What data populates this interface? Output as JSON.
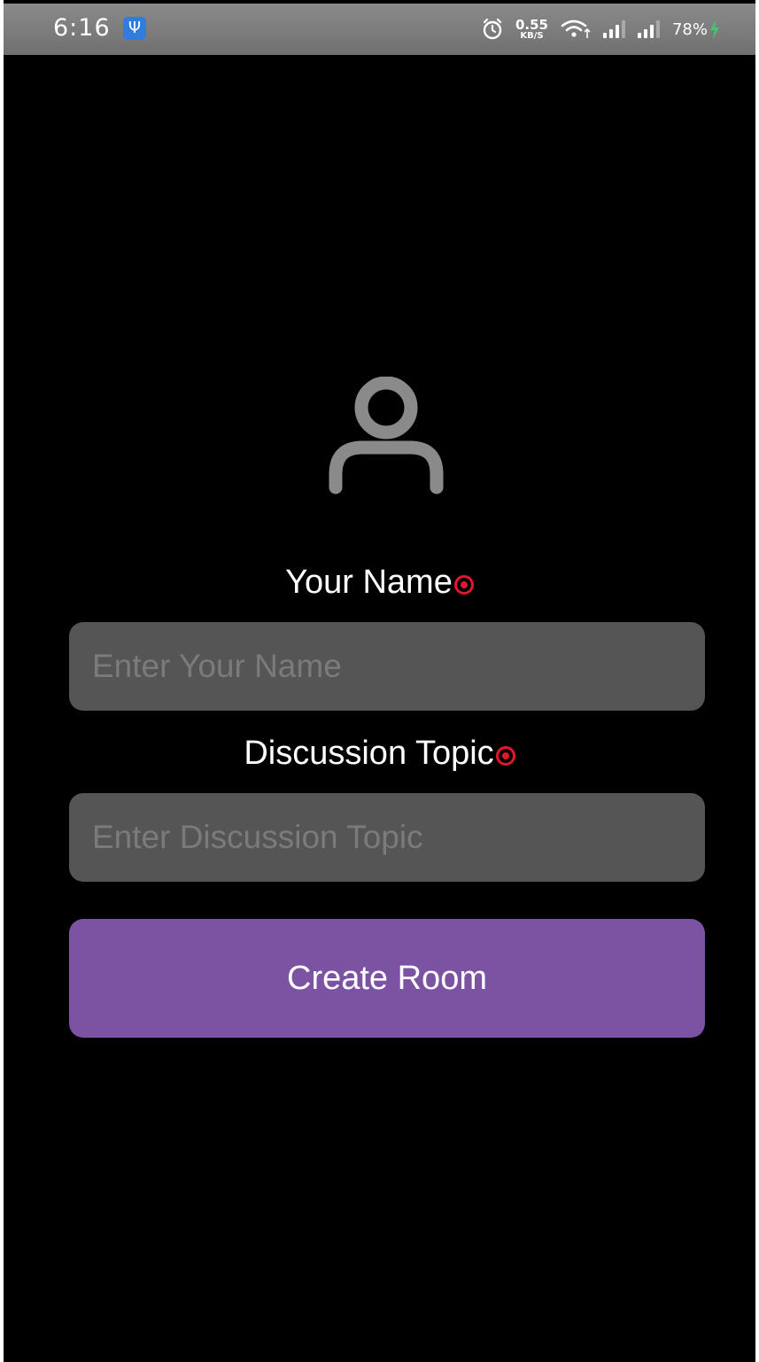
{
  "status_bar": {
    "time": "6:16",
    "usb_icon": "usb-icon",
    "net_speed_value": "0.55",
    "net_speed_unit": "KB/S",
    "battery": "78%",
    "icons": [
      "alarm-icon",
      "wifi-icon",
      "signal-icon",
      "signal-icon",
      "charging-icon"
    ]
  },
  "avatar": {
    "icon": "person-icon",
    "color": "#8a8a8a"
  },
  "form": {
    "name_label": "Your Name",
    "name_placeholder": "Enter Your Name",
    "name_value": "",
    "topic_label": "Discussion Topic",
    "topic_placeholder": "Enter Discussion Topic",
    "topic_value": "",
    "required_icon": "required-icon"
  },
  "actions": {
    "create_label": "Create Room"
  },
  "colors": {
    "background": "#000000",
    "status_bar": "#7c7c7c",
    "field_background": "#555555",
    "placeholder": "#7b7b7b",
    "button": "#7c52a3",
    "required_marker": "#e3162c",
    "charging": "#3ccc6f"
  }
}
